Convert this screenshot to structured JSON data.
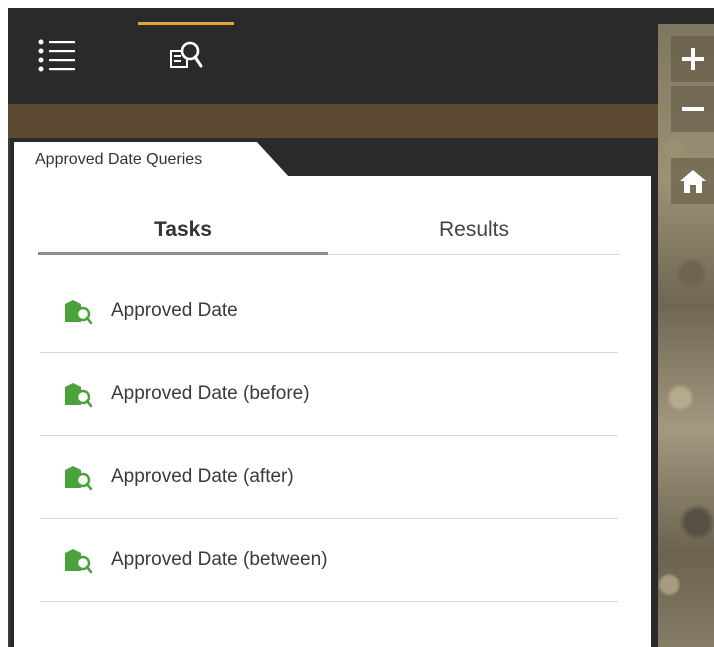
{
  "header": {
    "tools": [
      {
        "name": "layers-list",
        "icon": "list-icon",
        "active": false
      },
      {
        "name": "query",
        "icon": "query-search-icon",
        "active": true
      }
    ],
    "active_color": "#e3a23a"
  },
  "panel": {
    "title": "Approved Date Queries",
    "tabs": [
      {
        "label": "Tasks",
        "active": true
      },
      {
        "label": "Results",
        "active": false
      }
    ],
    "tasks": [
      {
        "label": "Approved Date",
        "icon": "query-layer-icon"
      },
      {
        "label": "Approved Date (before)",
        "icon": "query-layer-icon"
      },
      {
        "label": "Approved Date (after)",
        "icon": "query-layer-icon"
      },
      {
        "label": "Approved Date (between)",
        "icon": "query-layer-icon"
      }
    ],
    "icon_color": "#4aa33a"
  },
  "map": {
    "controls": [
      {
        "name": "zoom-in",
        "icon": "plus-icon"
      },
      {
        "name": "zoom-out",
        "icon": "minus-icon"
      },
      {
        "name": "home",
        "icon": "home-icon"
      }
    ]
  }
}
